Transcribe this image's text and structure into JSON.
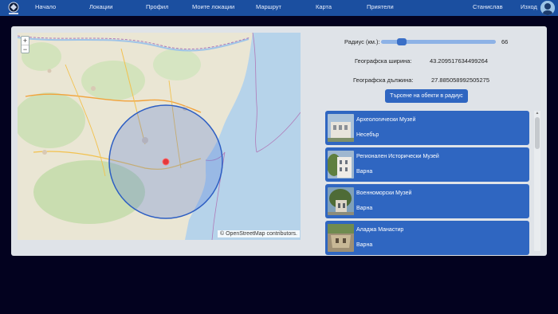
{
  "nav": {
    "items": [
      "Начало",
      "Локации",
      "Профил",
      "Моите локации",
      "Маршрут",
      "Карта",
      "Приятели"
    ],
    "user": "Станислав",
    "logout": "Изход"
  },
  "map": {
    "attribution": "© OpenStreetMap contributors.",
    "zoom_in": "+",
    "zoom_out": "−"
  },
  "search": {
    "radius_label": "Радиус (км.):",
    "radius_value": "66",
    "radius_fraction": 0.15,
    "lat_label": "Географска ширина:",
    "lat_value": "43.209517634499264",
    "lon_label": "Географска дължина:",
    "lon_value": "27.885058992505275",
    "button": "Търсене на обекти в радиус"
  },
  "results": [
    {
      "name": "Археологически Музей",
      "city": "Несебър"
    },
    {
      "name": "Регионален Исторически Музей",
      "city": "Варна"
    },
    {
      "name": "Военноморски Музей",
      "city": "Варна"
    },
    {
      "name": "Аладжа Манастир",
      "city": "Варна"
    }
  ],
  "colors": {
    "navbar": "#1b4fa0",
    "accent": "#2f66c1",
    "background": "#03021f"
  }
}
